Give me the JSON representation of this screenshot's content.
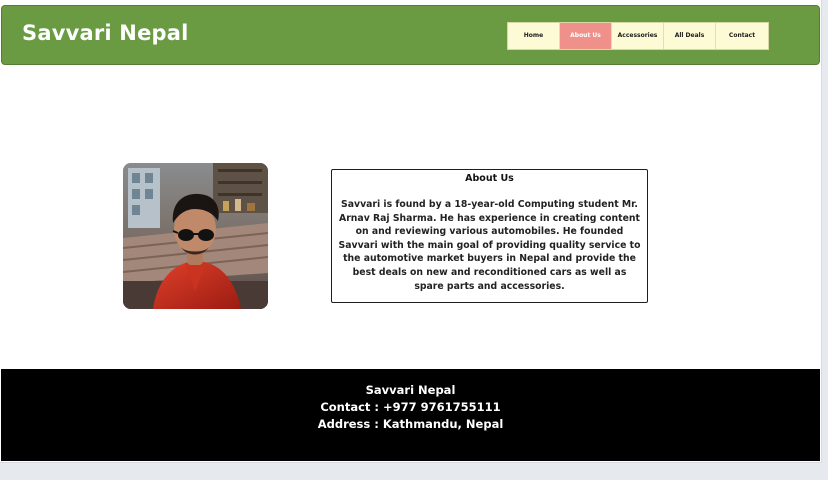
{
  "header": {
    "brand": "Savvari Nepal",
    "nav": [
      {
        "label": "Home",
        "active": false
      },
      {
        "label": "About Us",
        "active": true
      },
      {
        "label": "Accessories",
        "active": false
      },
      {
        "label": "All Deals",
        "active": false
      },
      {
        "label": "Contact",
        "active": false
      }
    ]
  },
  "about": {
    "photo_subject": "portrait of a man wearing sunglasses and a red jacket",
    "title": "About Us",
    "text": "Savvari is found by a 18-year-old Computing student Mr. Arnav Raj Sharma. He has experience in creating content on and reviewing various automobiles. He founded Savvari with the main goal of providing quality service to the automotive market buyers in Nepal and provide the best deals on new and reconditioned cars as well as spare parts and accessories."
  },
  "footer": {
    "name": "Savvari Nepal",
    "contact": "Contact : +977 9761755111",
    "address": "Address : Kathmandu, Nepal"
  },
  "colors": {
    "header_bg": "#6a9b43",
    "nav_bg": "#fdfbd6",
    "nav_active_bg": "#f0908a",
    "footer_bg": "#000000"
  }
}
